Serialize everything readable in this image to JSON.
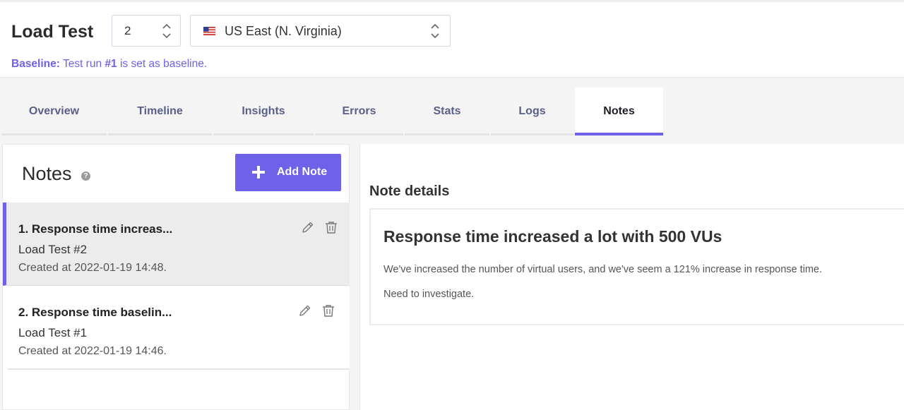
{
  "header": {
    "title": "Load Test",
    "run_select": {
      "value": "2"
    },
    "region_select": {
      "value": "US East (N. Virginia)",
      "flag_icon": "us-flag-icon"
    },
    "baseline": {
      "label": "Baseline:",
      "text_before": " Test run ",
      "run": "#1",
      "text_after": " is set as baseline."
    }
  },
  "tabs": [
    {
      "label": "Overview",
      "active": false
    },
    {
      "label": "Timeline",
      "active": false
    },
    {
      "label": "Insights",
      "active": false
    },
    {
      "label": "Errors",
      "active": false
    },
    {
      "label": "Stats",
      "active": false
    },
    {
      "label": "Logs",
      "active": false
    },
    {
      "label": "Notes",
      "active": true
    }
  ],
  "notes_panel": {
    "title": "Notes",
    "help_icon": "?",
    "add_button_label": "Add Note",
    "items": [
      {
        "title": "1. Response time increas...",
        "test": "Load Test #2",
        "created": "Created at 2022-01-19 14:48.",
        "selected": true
      },
      {
        "title": "2. Response time baselin...",
        "test": "Load Test #1",
        "created": "Created at 2022-01-19 14:46.",
        "selected": false
      }
    ]
  },
  "details": {
    "heading": "Note details",
    "title": "Response time increased a lot with 500 VUs",
    "paragraphs": [
      "We've increased the number of virtual users, and we've seem a 121% increase in response time.",
      "Need to investigate."
    ]
  },
  "colors": {
    "accent": "#6f61e8",
    "tab_text": "#5a5f87",
    "background": "#f4f4f5"
  }
}
